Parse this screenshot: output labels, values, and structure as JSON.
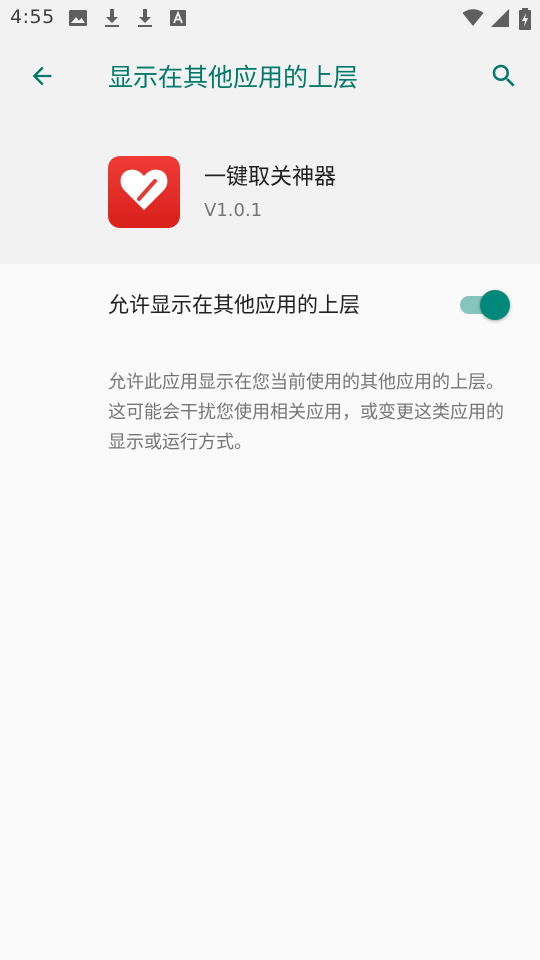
{
  "status_bar": {
    "time": "4:55",
    "icons": [
      "image-icon",
      "download-icon",
      "download-icon",
      "keyboard-a-icon",
      "wifi-icon",
      "signal-icon",
      "battery-charging-icon"
    ]
  },
  "toolbar": {
    "back_icon": "arrow-back-icon",
    "title": "显示在其他应用的上层",
    "search_icon": "search-icon"
  },
  "app": {
    "icon": "heart-icon",
    "name": "一键取关神器",
    "version": "V1.0.1"
  },
  "setting": {
    "label": "允许显示在其他应用的上层",
    "enabled": true,
    "description": "允许此应用显示在您当前使用的其他应用的上层。这可能会干扰您使用相关应用，或变更这类应用的显示或运行方式。"
  },
  "colors": {
    "accent": "#00796b",
    "toggle_thumb": "#00897b",
    "toggle_track": "#86c4bd",
    "app_icon": "#e53935",
    "header_bg": "#f2f2f2",
    "body_bg": "#fafafa"
  }
}
